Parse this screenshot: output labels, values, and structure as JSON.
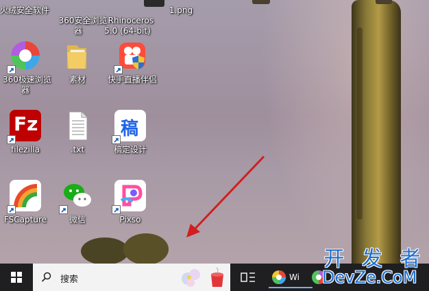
{
  "top_row": [
    {
      "label": "火绒安全软件"
    },
    {
      "label": "360安全浏览\n器"
    },
    {
      "label": "Rhinoceros\n5.0 (64-bit)"
    },
    {
      "label": "1.png"
    }
  ],
  "desktop_icons": [
    {
      "label": "360极速浏览\n器",
      "icon": "360-speed-browser-icon"
    },
    {
      "label": "素材",
      "icon": "folder-icon"
    },
    {
      "label": "快手直播伴侣",
      "icon": "kuaishou-live-icon"
    },
    {
      "label": "filezilla",
      "icon": "filezilla-icon"
    },
    {
      "label": ".txt",
      "icon": "text-file-icon"
    },
    {
      "label": "稿定设计",
      "icon": "gaoding-design-icon"
    },
    {
      "label": "FSCapture",
      "icon": "fscapture-icon"
    },
    {
      "label": "微信",
      "icon": "wechat-icon"
    },
    {
      "label": "Pixso",
      "icon": "pixso-icon"
    }
  ],
  "gaoding_glyph": "稿",
  "filezilla_glyph": "Fz",
  "taskbar": {
    "search_placeholder": "搜索",
    "app1_label": "Wi"
  },
  "watermark": {
    "line1": "开 发 者",
    "line2": "DevZe.CoM"
  },
  "colors": {
    "taskbar": "#1f1f22",
    "arrow": "#d21e1e",
    "watermark": "#1e6fd0"
  }
}
